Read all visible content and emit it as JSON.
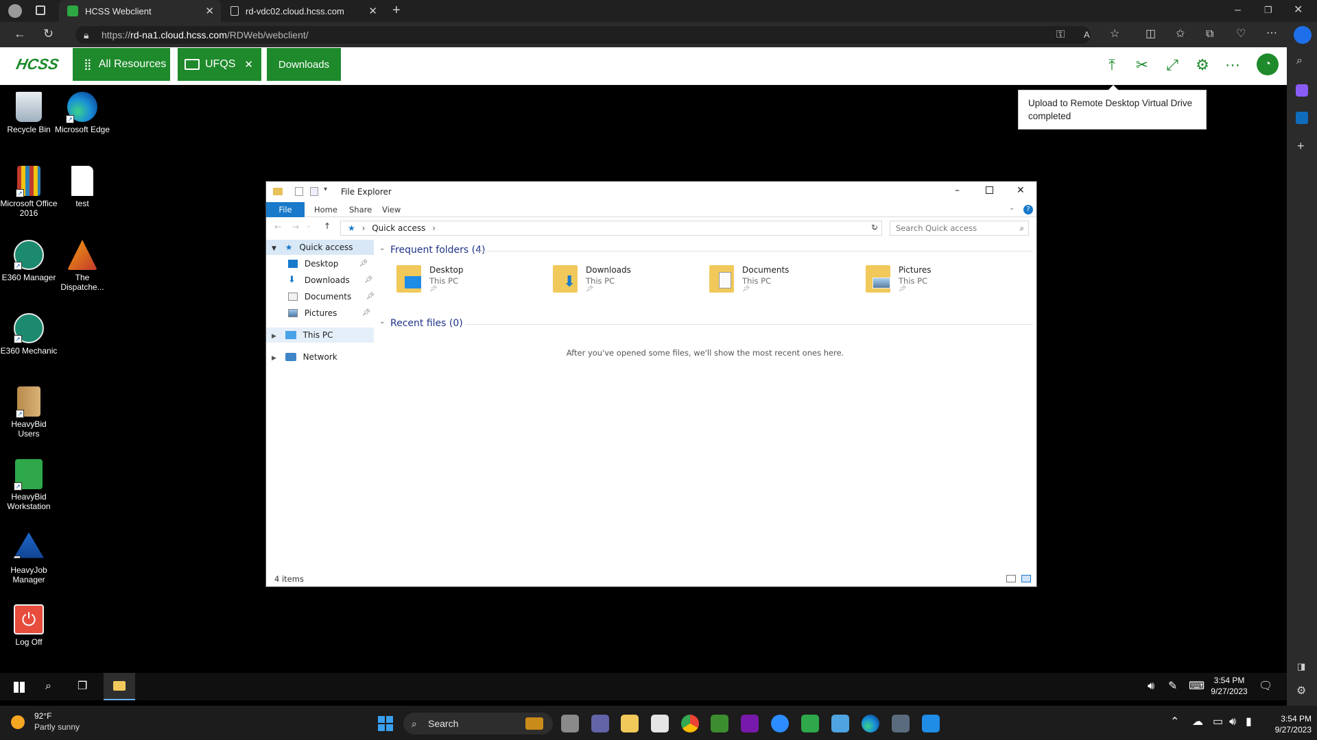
{
  "browser": {
    "tabs": [
      {
        "title": "HCSS Webclient",
        "active": true
      },
      {
        "title": "rd-vdc02.cloud.hcss.com",
        "active": false
      }
    ],
    "url_prefix": "https://",
    "url_host": "rd-na1.cloud.hcss.com",
    "url_path": "/RDWeb/webclient/"
  },
  "webapp": {
    "logo_text": "HCSS",
    "all_resources_label": "All Resources",
    "ufqs_label": "UFQS",
    "downloads_label": "Downloads",
    "toast_text": "Upload to Remote Desktop Virtual Drive completed",
    "accent_color": "#1e8a2b"
  },
  "desktop_icons": [
    {
      "label": "Recycle Bin",
      "icon": "recycle-bin-icon"
    },
    {
      "label": "Microsoft Edge",
      "icon": "edge-icon"
    },
    {
      "label": "Microsoft Office 2016",
      "icon": "office-icon"
    },
    {
      "label": "test",
      "icon": "text-file-icon"
    },
    {
      "label": "E360 Manager",
      "icon": "e360-manager-icon"
    },
    {
      "label": "The Dispatche...",
      "icon": "dispatcher-icon"
    },
    {
      "label": "E360 Mechanic",
      "icon": "e360-mechanic-icon"
    },
    {
      "label": "HeavyBid Users",
      "icon": "heavybid-users-icon"
    },
    {
      "label": "HeavyBid Workstation",
      "icon": "heavybid-workstation-icon"
    },
    {
      "label": "HeavyJob Manager",
      "icon": "heavyjob-icon"
    },
    {
      "label": "Log Off",
      "icon": "log-off-icon"
    }
  ],
  "explorer": {
    "title": "File Explorer",
    "ribbon_tabs": [
      "File",
      "Home",
      "Share",
      "View"
    ],
    "breadcrumb": "Quick access",
    "search_placeholder": "Search Quick access",
    "tree": {
      "quick_access": "Quick access",
      "items": [
        "Desktop",
        "Downloads",
        "Documents",
        "Pictures"
      ],
      "this_pc": "This PC",
      "network": "Network"
    },
    "frequent_header": "Frequent folders (4)",
    "folders": [
      {
        "name": "Desktop",
        "location": "This PC"
      },
      {
        "name": "Downloads",
        "location": "This PC"
      },
      {
        "name": "Documents",
        "location": "This PC"
      },
      {
        "name": "Pictures",
        "location": "This PC"
      }
    ],
    "recent_header": "Recent files (0)",
    "recent_empty": "After you've opened some files, we'll show the most recent ones here.",
    "status": "4 items"
  },
  "remote_taskbar": {
    "time": "3:54 PM",
    "date": "9/27/2023"
  },
  "local_taskbar": {
    "weather_temp": "92°F",
    "weather_desc": "Partly sunny",
    "search_label": "Search",
    "time": "3:54 PM",
    "date": "9/27/2023"
  }
}
